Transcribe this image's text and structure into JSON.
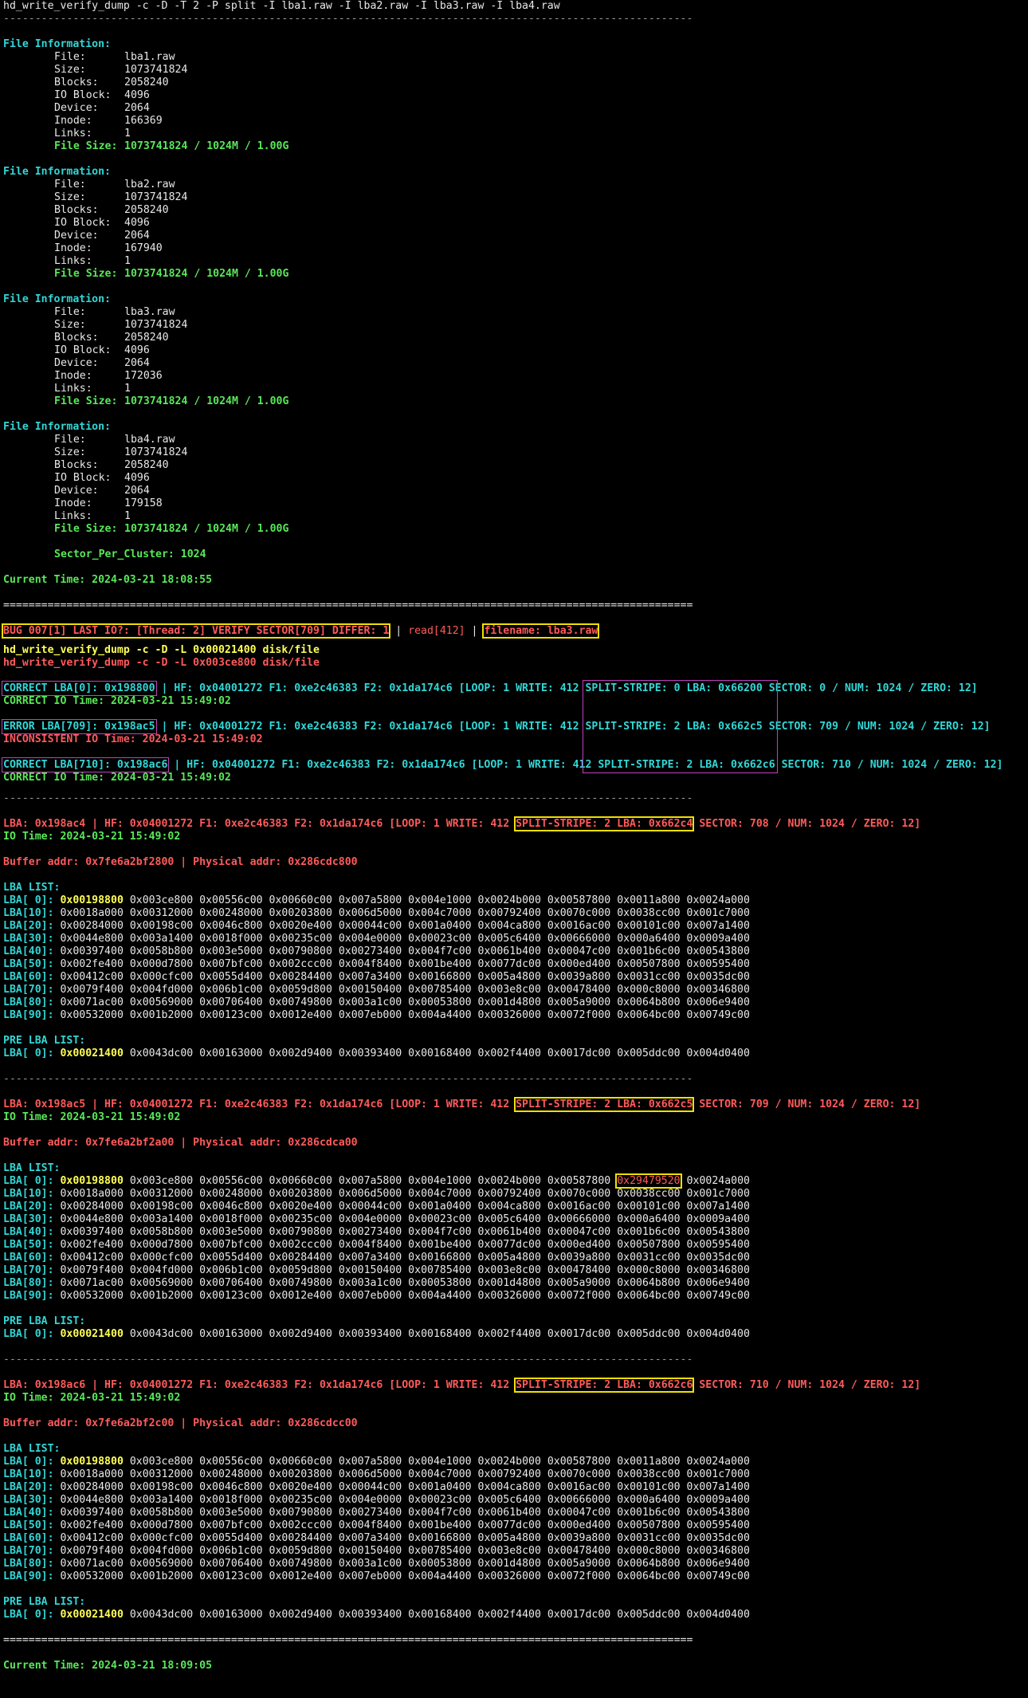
{
  "cmd": "hd_write_verify_dump -c -D -T 2 -P split -I lba1.raw -I lba2.raw -I lba3.raw -I lba4.raw",
  "dash_line": "-------------------------------------------------------------------------------------------------------------",
  "eq_line": "=============================================================================================================",
  "files": [
    {
      "header": "File Information:",
      "file": "lba1.raw",
      "size": "1073741824",
      "blocks": "2058240",
      "ioblock": "4096",
      "device": "2064",
      "inode": "166369",
      "links": "1",
      "filesize": "1073741824 / 1024M / 1.00G"
    },
    {
      "header": "File Information:",
      "file": "lba2.raw",
      "size": "1073741824",
      "blocks": "2058240",
      "ioblock": "4096",
      "device": "2064",
      "inode": "167940",
      "links": "1",
      "filesize": "1073741824 / 1024M / 1.00G"
    },
    {
      "header": "File Information:",
      "file": "lba3.raw",
      "size": "1073741824",
      "blocks": "2058240",
      "ioblock": "4096",
      "device": "2064",
      "inode": "172036",
      "links": "1",
      "filesize": "1073741824 / 1024M / 1.00G"
    },
    {
      "header": "File Information:",
      "file": "lba4.raw",
      "size": "1073741824",
      "blocks": "2058240",
      "ioblock": "4096",
      "device": "2064",
      "inode": "179158",
      "links": "1",
      "filesize": "1073741824 / 1024M / 1.00G"
    }
  ],
  "labels": {
    "file": "File:",
    "size": "Size:",
    "blocks": "Blocks:",
    "ioblock": "IO Block:",
    "device": "Device:",
    "inode": "Inode:",
    "links": "Links:",
    "filesize": "File Size:"
  },
  "sector_per_cluster": "Sector_Per_Cluster: 1024",
  "current_time_1": "Current Time: 2024-03-21 18:08:55",
  "current_time_2": "Current Time: 2024-03-21 18:09:05",
  "bug": {
    "text": "BUG 007[1] LAST IO?: [Thread: 2] VERIFY SECTOR[709] DIFFER: 1",
    "sep1": " | ",
    "read": "read[412]",
    "sep2": " | ",
    "filename": "filename: lba3.raw"
  },
  "dump_cmd_1": "hd_write_verify_dump -c -D -L 0x00021400 disk/file",
  "dump_cmd_2": "hd_write_verify_dump -c -D -L 0x003ce800 disk/file",
  "correct_block": [
    {
      "tag": "CORRECT LBA[0]: 0x198800",
      "a": " | HF: 0x04001272 F1: 0xe2c46383 F2: 0x1da174c6 [LOOP: 1 WRITE: 412 ",
      "b": "SPLIT-STRIPE: 0 LBA: 0x66200",
      "c": " SECTOR: 0 / NUM: 1024 / ZERO: 12]",
      "time": "CORRECT IO Time: 2024-03-21 15:49:02",
      "err": false
    },
    {
      "tag": "ERROR LBA[709]: 0x198ac5",
      "a": " | HF: 0x04001272 F1: 0xe2c46383 F2: 0x1da174c6 [LOOP: 1 WRITE: 412 ",
      "b": "SPLIT-STRIPE: 2 LBA: 0x662c5",
      "c": " SECTOR: 709 / NUM: 1024 / ZERO: 12]",
      "time": "INCONSISTENT IO Time: 2024-03-21 15:49:02",
      "err": true
    },
    {
      "tag": "CORRECT LBA[710]: 0x198ac6",
      "a": " | HF: 0x04001272 F1: 0xe2c46383 F2: 0x1da174c6 [LOOP: 1 WRITE: 412 ",
      "b": "SPLIT-STRIPE: 2 LBA: 0x662c6",
      "c": " SECTOR: 710 / NUM: 1024 / ZERO: 12]",
      "time": "CORRECT IO Time: 2024-03-21 15:49:02",
      "err": false
    }
  ],
  "sections": [
    {
      "lba_pre": "LBA: 0x198ac4 | HF: 0x04001272 F1: 0xe2c46383 F2: 0x1da174c6 [LOOP: 1 WRITE: 412 ",
      "lba_box": "SPLIT-STRIPE: 2 LBA: 0x662c4",
      "lba_post": " SECTOR: 708 / NUM: 1024 / ZERO: 12]",
      "io_time": "IO Time: 2024-03-21 15:49:02",
      "buffer": "Buffer addr: 0x7fe6a2bf2800 | Physical addr: 0x286cdc800",
      "list_title": "LBA LIST:",
      "rows": [
        {
          "label": "LBA[ 0]:",
          "first": "0x00198800",
          "rest": "0x003ce800 0x00556c00 0x00660c00 0x007a5800 0x004e1000 0x0024b000 0x00587800 0x0011a800 0x0024a000"
        },
        {
          "label": "LBA[10]:",
          "first": "0x0018a000",
          "rest": "0x00312000 0x00248000 0x00203800 0x006d5000 0x004c7000 0x00792400 0x0070c000 0x0038cc00 0x001c7000"
        },
        {
          "label": "LBA[20]:",
          "first": "0x00284000",
          "rest": "0x00198c00 0x0046c800 0x0020e400 0x00044c00 0x001a0400 0x004ca800 0x0016ac00 0x00101c00 0x007a1400"
        },
        {
          "label": "LBA[30]:",
          "first": "0x0044e800",
          "rest": "0x003a1400 0x0018f000 0x00235c00 0x004e0000 0x00023c00 0x005c6400 0x00666000 0x000a6400 0x0009a400"
        },
        {
          "label": "LBA[40]:",
          "first": "0x00397400",
          "rest": "0x0058b800 0x003e5000 0x00790800 0x00273400 0x004f7c00 0x0061b400 0x00047c00 0x001b6c00 0x00543800"
        },
        {
          "label": "LBA[50]:",
          "first": "0x002fe400",
          "rest": "0x000d7800 0x007bfc00 0x002ccc00 0x004f8400 0x001be400 0x0077dc00 0x000ed400 0x00507800 0x00595400"
        },
        {
          "label": "LBA[60]:",
          "first": "0x00412c00",
          "rest": "0x000cfc00 0x0055d400 0x00284400 0x007a3400 0x00166800 0x005a4800 0x0039a800 0x0031cc00 0x0035dc00"
        },
        {
          "label": "LBA[70]:",
          "first": "0x0079f400",
          "rest": "0x004fd000 0x006b1c00 0x0059d800 0x00150400 0x00785400 0x003e8c00 0x00478400 0x000c8000 0x00346800"
        },
        {
          "label": "LBA[80]:",
          "first": "0x0071ac00",
          "rest": "0x00569000 0x00706400 0x00749800 0x003a1c00 0x00053800 0x001d4800 0x005a9000 0x0064b800 0x006e9400"
        },
        {
          "label": "LBA[90]:",
          "first": "0x00532000",
          "rest": "0x001b2000 0x00123c00 0x0012e400 0x007eb000 0x004a4400 0x00326000 0x0072f000 0x0064bc00 0x00749c00"
        }
      ],
      "pre_title": "PRE LBA LIST:",
      "pre_label": "LBA[ 0]:",
      "pre_first": "0x00021400",
      "pre_rest": "0x0043dc00 0x00163000 0x002d9400 0x00393400 0x00168400 0x002f4400 0x0017dc00 0x005ddc00 0x004d0400"
    },
    {
      "lba_pre": "LBA: 0x198ac5 | HF: 0x04001272 F1: 0xe2c46383 F2: 0x1da174c6 [LOOP: 1 WRITE: 412 ",
      "lba_box": "SPLIT-STRIPE: 2 LBA: 0x662c5",
      "lba_post": " SECTOR: 709 / NUM: 1024 / ZERO: 12]",
      "io_time": "IO Time: 2024-03-21 15:49:02",
      "buffer": "Buffer addr: 0x7fe6a2bf2a00 | Physical addr: 0x286cdca00",
      "list_title": "LBA LIST:",
      "row0_pre": "0x003ce800 0x00556c00 0x00660c00 0x007a5800 0x004e1000 0x0024b000 0x00587800",
      "row0_err": "0x29479520",
      "row0_post": "0x0024a000",
      "rows": [
        {
          "label": "LBA[ 0]:",
          "first": "0x00198800",
          "rest": ""
        },
        {
          "label": "LBA[10]:",
          "first": "0x0018a000",
          "rest": "0x00312000 0x00248000 0x00203800 0x006d5000 0x004c7000 0x00792400 0x0070c000 0x0038cc00 0x001c7000"
        },
        {
          "label": "LBA[20]:",
          "first": "0x00284000",
          "rest": "0x00198c00 0x0046c800 0x0020e400 0x00044c00 0x001a0400 0x004ca800 0x0016ac00 0x00101c00 0x007a1400"
        },
        {
          "label": "LBA[30]:",
          "first": "0x0044e800",
          "rest": "0x003a1400 0x0018f000 0x00235c00 0x004e0000 0x00023c00 0x005c6400 0x00666000 0x000a6400 0x0009a400"
        },
        {
          "label": "LBA[40]:",
          "first": "0x00397400",
          "rest": "0x0058b800 0x003e5000 0x00790800 0x00273400 0x004f7c00 0x0061b400 0x00047c00 0x001b6c00 0x00543800"
        },
        {
          "label": "LBA[50]:",
          "first": "0x002fe400",
          "rest": "0x000d7800 0x007bfc00 0x002ccc00 0x004f8400 0x001be400 0x0077dc00 0x000ed400 0x00507800 0x00595400"
        },
        {
          "label": "LBA[60]:",
          "first": "0x00412c00",
          "rest": "0x000cfc00 0x0055d400 0x00284400 0x007a3400 0x00166800 0x005a4800 0x0039a800 0x0031cc00 0x0035dc00"
        },
        {
          "label": "LBA[70]:",
          "first": "0x0079f400",
          "rest": "0x004fd000 0x006b1c00 0x0059d800 0x00150400 0x00785400 0x003e8c00 0x00478400 0x000c8000 0x00346800"
        },
        {
          "label": "LBA[80]:",
          "first": "0x0071ac00",
          "rest": "0x00569000 0x00706400 0x00749800 0x003a1c00 0x00053800 0x001d4800 0x005a9000 0x0064b800 0x006e9400"
        },
        {
          "label": "LBA[90]:",
          "first": "0x00532000",
          "rest": "0x001b2000 0x00123c00 0x0012e400 0x007eb000 0x004a4400 0x00326000 0x0072f000 0x0064bc00 0x00749c00"
        }
      ],
      "pre_title": "PRE LBA LIST:",
      "pre_label": "LBA[ 0]:",
      "pre_first": "0x00021400",
      "pre_rest": "0x0043dc00 0x00163000 0x002d9400 0x00393400 0x00168400 0x002f4400 0x0017dc00 0x005ddc00 0x004d0400"
    },
    {
      "lba_pre": "LBA: 0x198ac6 | HF: 0x04001272 F1: 0xe2c46383 F2: 0x1da174c6 [LOOP: 1 WRITE: 412 ",
      "lba_box": "SPLIT-STRIPE: 2 LBA: 0x662c6",
      "lba_post": " SECTOR: 710 / NUM: 1024 / ZERO: 12]",
      "io_time": "IO Time: 2024-03-21 15:49:02",
      "buffer": "Buffer addr: 0x7fe6a2bf2c00 | Physical addr: 0x286cdcc00",
      "list_title": "LBA LIST:",
      "rows": [
        {
          "label": "LBA[ 0]:",
          "first": "0x00198800",
          "rest": "0x003ce800 0x00556c00 0x00660c00 0x007a5800 0x004e1000 0x0024b000 0x00587800 0x0011a800 0x0024a000"
        },
        {
          "label": "LBA[10]:",
          "first": "0x0018a000",
          "rest": "0x00312000 0x00248000 0x00203800 0x006d5000 0x004c7000 0x00792400 0x0070c000 0x0038cc00 0x001c7000"
        },
        {
          "label": "LBA[20]:",
          "first": "0x00284000",
          "rest": "0x00198c00 0x0046c800 0x0020e400 0x00044c00 0x001a0400 0x004ca800 0x0016ac00 0x00101c00 0x007a1400"
        },
        {
          "label": "LBA[30]:",
          "first": "0x0044e800",
          "rest": "0x003a1400 0x0018f000 0x00235c00 0x004e0000 0x00023c00 0x005c6400 0x00666000 0x000a6400 0x0009a400"
        },
        {
          "label": "LBA[40]:",
          "first": "0x00397400",
          "rest": "0x0058b800 0x003e5000 0x00790800 0x00273400 0x004f7c00 0x0061b400 0x00047c00 0x001b6c00 0x00543800"
        },
        {
          "label": "LBA[50]:",
          "first": "0x002fe400",
          "rest": "0x000d7800 0x007bfc00 0x002ccc00 0x004f8400 0x001be400 0x0077dc00 0x000ed400 0x00507800 0x00595400"
        },
        {
          "label": "LBA[60]:",
          "first": "0x00412c00",
          "rest": "0x000cfc00 0x0055d400 0x00284400 0x007a3400 0x00166800 0x005a4800 0x0039a800 0x0031cc00 0x0035dc00"
        },
        {
          "label": "LBA[70]:",
          "first": "0x0079f400",
          "rest": "0x004fd000 0x006b1c00 0x0059d800 0x00150400 0x00785400 0x003e8c00 0x00478400 0x000c8000 0x00346800"
        },
        {
          "label": "LBA[80]:",
          "first": "0x0071ac00",
          "rest": "0x00569000 0x00706400 0x00749800 0x003a1c00 0x00053800 0x001d4800 0x005a9000 0x0064b800 0x006e9400"
        },
        {
          "label": "LBA[90]:",
          "first": "0x00532000",
          "rest": "0x001b2000 0x00123c00 0x0012e400 0x007eb000 0x004a4400 0x00326000 0x0072f000 0x0064bc00 0x00749c00"
        }
      ],
      "pre_title": "PRE LBA LIST:",
      "pre_label": "LBA[ 0]:",
      "pre_first": "0x00021400",
      "pre_rest": "0x0043dc00 0x00163000 0x002d9400 0x00393400 0x00168400 0x002f4400 0x0017dc00 0x005ddc00 0x004d0400"
    }
  ]
}
